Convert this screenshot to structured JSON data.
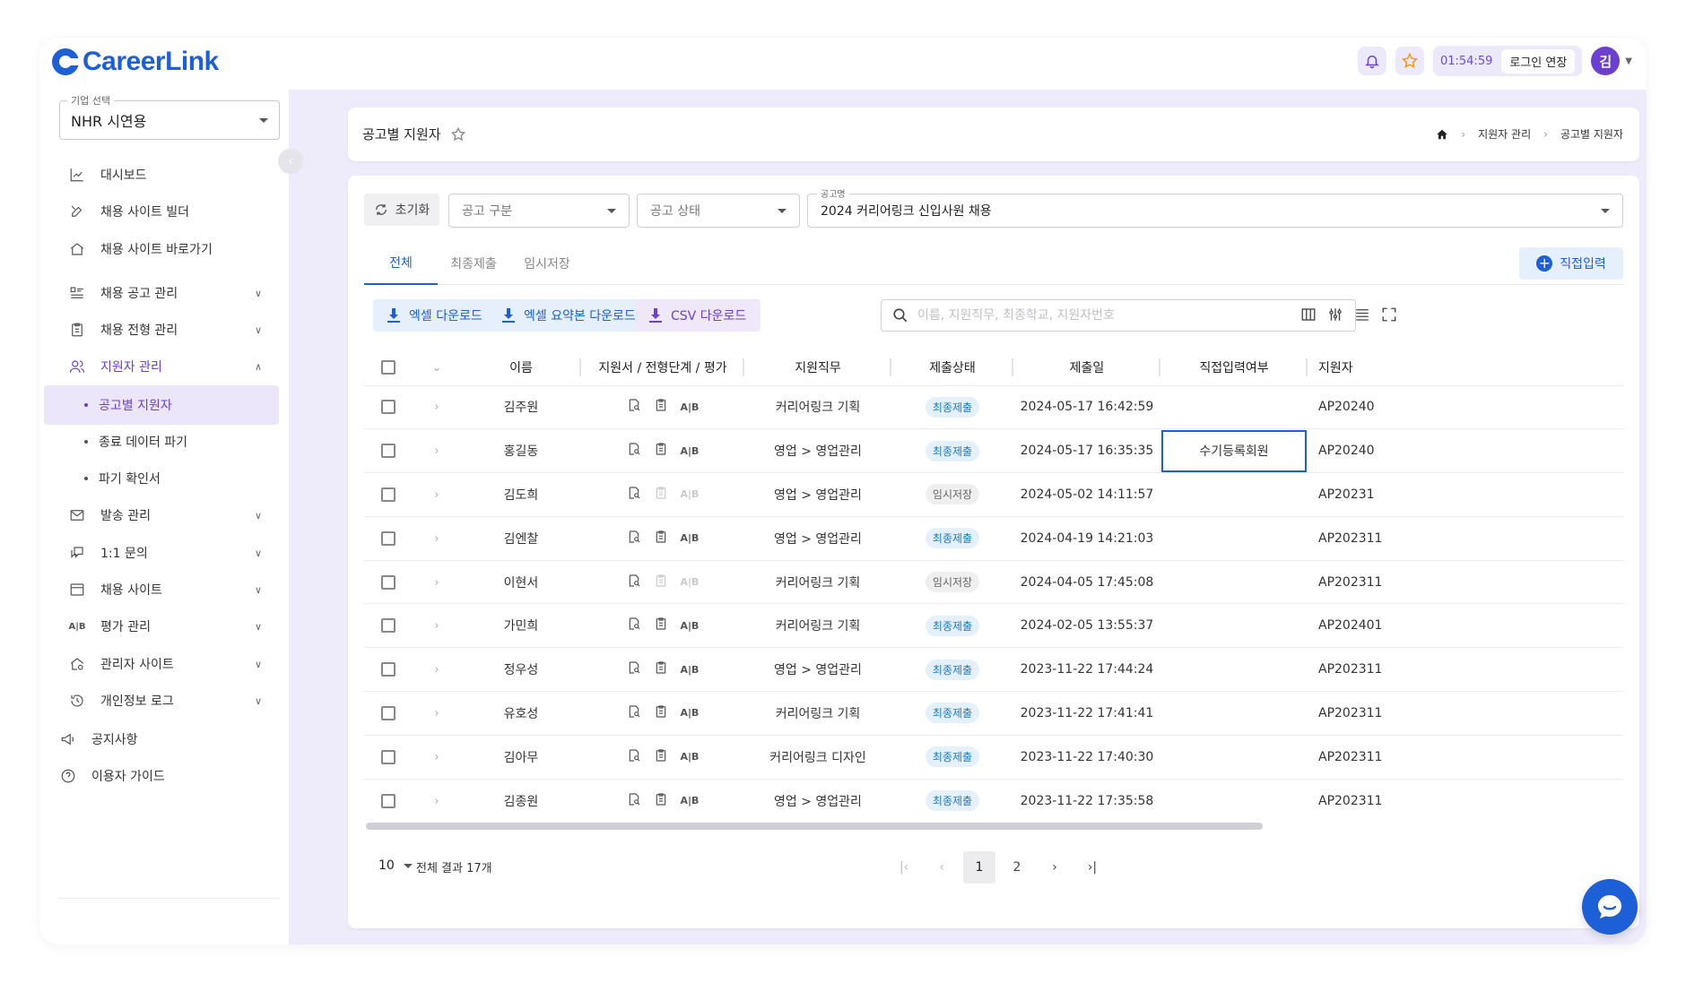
{
  "app": {
    "logo_text": "CareerLink"
  },
  "header": {
    "timer": "01:54:59",
    "extend_label": "로그인 연장",
    "avatar_initial": "김",
    "icons": [
      "bell-icon",
      "star-icon"
    ]
  },
  "sidebar": {
    "company_legend": "기업 선택",
    "company_value": "NHR 시연용",
    "items": [
      {
        "label": "대시보드",
        "icon": "chart-icon"
      },
      {
        "label": "채용 사이트 빌더",
        "icon": "tools-icon"
      },
      {
        "label": "채용 사이트 바로가기",
        "icon": "home-link-icon"
      },
      {
        "label": "채용 공고 관리",
        "icon": "list-icon"
      },
      {
        "label": "채용 전형 관리",
        "icon": "clipboard-icon"
      },
      {
        "label": "지원자 관리",
        "icon": "users-icon"
      },
      {
        "label": "발송 관리",
        "icon": "mail-icon"
      },
      {
        "label": "1:1 문의",
        "icon": "chat-icon"
      },
      {
        "label": "채용 사이트",
        "icon": "browser-icon"
      },
      {
        "label": "평가 관리",
        "icon": "ab-icon"
      },
      {
        "label": "관리자 사이트",
        "icon": "admin-home-icon"
      },
      {
        "label": "개인정보 로그",
        "icon": "history-icon"
      }
    ],
    "subitems": [
      {
        "label": "공고별 지원자"
      },
      {
        "label": "종료 데이터 파기"
      },
      {
        "label": "파기 확인서"
      }
    ],
    "footer": [
      {
        "label": "공지사항",
        "icon": "megaphone-icon"
      },
      {
        "label": "이용자 가이드",
        "icon": "help-icon"
      }
    ]
  },
  "page": {
    "title": "공고별 지원자",
    "breadcrumb": [
      "지원자 관리",
      "공고별 지원자"
    ]
  },
  "filters": {
    "reset_label": "초기화",
    "type_placeholder": "공고 구분",
    "status_placeholder": "공고 상태",
    "posting_legend": "공고명",
    "posting_value": "2024 커리어링크 신입사원 채용"
  },
  "tabs": [
    {
      "label": "전체",
      "active": true
    },
    {
      "label": "최종제출",
      "active": false
    },
    {
      "label": "임시저장",
      "active": false
    }
  ],
  "direct_input_label": "직접입력",
  "toolbar": {
    "excel_download": "엑셀 다운로드",
    "excel_summary_download": "엑셀 요약본 다운로드",
    "csv_download": "CSV 다운로드",
    "search_placeholder": "이름, 지원직무, 최종학교, 지원자번호"
  },
  "table": {
    "columns": [
      "이름",
      "지원서 / 전형단계 / 평가",
      "지원직무",
      "제출상태",
      "제출일",
      "직접입력여부",
      "지원자"
    ],
    "rows": [
      {
        "name": "김주원",
        "job": "커리어링크 기획",
        "status": "최종제출",
        "date": "2024-05-17 16:42:59",
        "direct": "",
        "id": "AP20240",
        "docs_enabled": true
      },
      {
        "name": "홍길동",
        "job": "영업 > 영업관리",
        "status": "최종제출",
        "date": "2024-05-17 16:35:35",
        "direct": "수기등록회원",
        "id": "AP20240",
        "docs_enabled": true
      },
      {
        "name": "김도희",
        "job": "영업 > 영업관리",
        "status": "임시저장",
        "date": "2024-05-02 14:11:57",
        "direct": "",
        "id": "AP20231",
        "docs_enabled": false
      },
      {
        "name": "김엔찰",
        "job": "영업 > 영업관리",
        "status": "최종제출",
        "date": "2024-04-19 14:21:03",
        "direct": "",
        "id": "AP202311",
        "docs_enabled": true
      },
      {
        "name": "이현서",
        "job": "커리어링크 기획",
        "status": "임시저장",
        "date": "2024-04-05 17:45:08",
        "direct": "",
        "id": "AP202311",
        "docs_enabled": false
      },
      {
        "name": "가민희",
        "job": "커리어링크 기획",
        "status": "최종제출",
        "date": "2024-02-05 13:55:37",
        "direct": "",
        "id": "AP202401",
        "docs_enabled": true
      },
      {
        "name": "정우성",
        "job": "영업 > 영업관리",
        "status": "최종제출",
        "date": "2023-11-22 17:44:24",
        "direct": "",
        "id": "AP202311",
        "docs_enabled": true
      },
      {
        "name": "유호성",
        "job": "커리어링크 기획",
        "status": "최종제출",
        "date": "2023-11-22 17:41:41",
        "direct": "",
        "id": "AP202311",
        "docs_enabled": true
      },
      {
        "name": "김아무",
        "job": "커리어링크 디자인",
        "status": "최종제출",
        "date": "2023-11-22 17:40:30",
        "direct": "",
        "id": "AP202311",
        "docs_enabled": true
      },
      {
        "name": "김종원",
        "job": "영업 > 영업관리",
        "status": "최종제출",
        "date": "2023-11-22 17:35:58",
        "direct": "",
        "id": "AP202311",
        "docs_enabled": true
      }
    ]
  },
  "pagination": {
    "per_page": "10",
    "total_label": "전체 결과 17개",
    "pages": [
      "1",
      "2"
    ],
    "current": "1"
  },
  "colors": {
    "primary": "#1d5fd6",
    "purple": "#6b3fd0",
    "main_bg": "#eeecfb"
  }
}
